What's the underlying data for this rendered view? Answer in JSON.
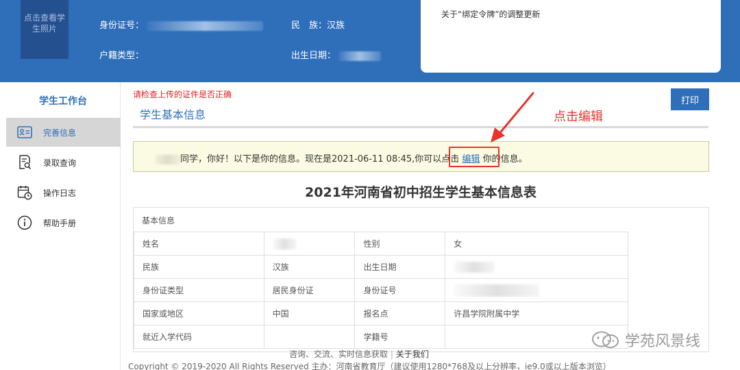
{
  "header": {
    "photo_label": "点击查看学生照片",
    "id_label": "身份证号：",
    "ethnicity_label": "民　族：",
    "ethnicity_value": "汉族",
    "household_label": "户籍类型：",
    "birth_label": "出生日期：",
    "notice_text": "关于“绑定令牌”的调整更新"
  },
  "sidebar": {
    "title": "学生工作台",
    "items": [
      {
        "label": "完善信息",
        "icon": "id-card-icon",
        "active": true
      },
      {
        "label": "录取查询",
        "icon": "document-search-icon",
        "active": false
      },
      {
        "label": "操作日志",
        "icon": "calendar-clock-icon",
        "active": false
      },
      {
        "label": "帮助手册",
        "icon": "info-icon",
        "active": false
      }
    ]
  },
  "main": {
    "warning": "请检查上传的证件是否正确",
    "title": "学生基本信息",
    "print_button": "打印",
    "annotation": "点击编辑",
    "info": {
      "prefix": "同学，你好！以下是你的信息。现在是2021-06-11 08:45,你可以点击 ",
      "edit_link": "编辑",
      "suffix": " 你的信息。"
    },
    "table_title": "2021年河南省初中招生学生基本信息表",
    "section_label": "基本信息",
    "rows": [
      {
        "l1": "姓名",
        "v1": "",
        "l2": "性别",
        "v2": "女"
      },
      {
        "l1": "民族",
        "v1": "汉族",
        "l2": "出生日期",
        "v2": ""
      },
      {
        "l1": "身份证类型",
        "v1": "居民身份证",
        "l2": "身份证号",
        "v2": ""
      },
      {
        "l1": "国家或地区",
        "v1": "中国",
        "l2": "报名点",
        "v2": "许昌学院附属中学"
      },
      {
        "l1": "就近入学代码",
        "v1": "",
        "l2": "学籍号",
        "v2": ""
      }
    ]
  },
  "footer": {
    "links": "咨询、交流、实时信息获取",
    "about": "关于我们",
    "copyright": "Copyright © 2019-2020 All Rights Reserved 主办：河南省教育厅（建议使用1280*768及以上分辨率，ie9.0或以上版本浏览）"
  },
  "watermark": "学苑风景线",
  "colors": {
    "primary": "#2f6fba",
    "warning": "#e02020",
    "annotation": "#e8332d",
    "info_bg": "#fbfbe3"
  }
}
